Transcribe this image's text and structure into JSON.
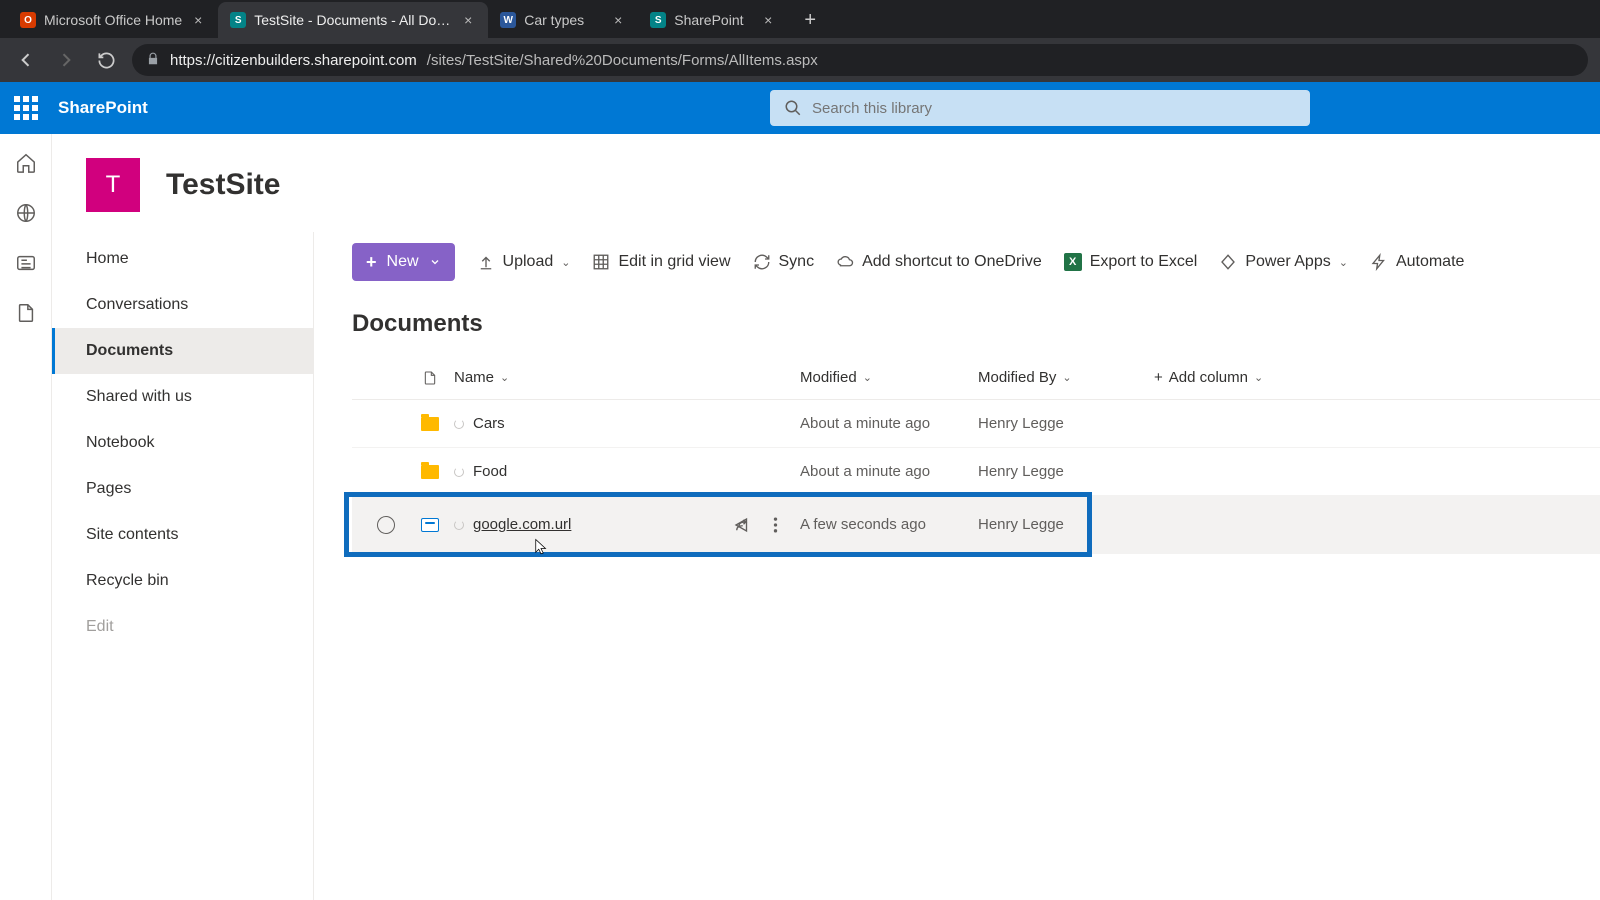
{
  "browser": {
    "tabs": [
      {
        "title": "Microsoft Office Home",
        "favicon": "office"
      },
      {
        "title": "TestSite - Documents - All Docum",
        "favicon": "sp",
        "active": true
      },
      {
        "title": "Car types",
        "favicon": "word"
      },
      {
        "title": "SharePoint",
        "favicon": "sp"
      }
    ],
    "url_host": "https://citizenbuilders.sharepoint.com",
    "url_path": "/sites/TestSite/Shared%20Documents/Forms/AllItems.aspx"
  },
  "suite": {
    "product": "SharePoint",
    "search_placeholder": "Search this library"
  },
  "site": {
    "logo_letter": "T",
    "title": "TestSite"
  },
  "leftnav": {
    "items": [
      "Home",
      "Conversations",
      "Documents",
      "Shared with us",
      "Notebook",
      "Pages",
      "Site contents",
      "Recycle bin"
    ],
    "edit": "Edit",
    "selected_index": 2
  },
  "commands": {
    "new": "New",
    "upload": "Upload",
    "edit_grid": "Edit in grid view",
    "sync": "Sync",
    "add_shortcut": "Add shortcut to OneDrive",
    "export_excel": "Export to Excel",
    "power_apps": "Power Apps",
    "automate": "Automate"
  },
  "library": {
    "title": "Documents",
    "columns": {
      "name": "Name",
      "modified": "Modified",
      "modified_by": "Modified By",
      "add_column": "Add column"
    },
    "rows": [
      {
        "type": "folder",
        "name": "Cars",
        "modified": "About a minute ago",
        "modified_by": "Henry Legge"
      },
      {
        "type": "folder",
        "name": "Food",
        "modified": "About a minute ago",
        "modified_by": "Henry Legge"
      },
      {
        "type": "link",
        "name": "google.com.url",
        "modified": "A few seconds ago",
        "modified_by": "Henry Legge",
        "hovered": true,
        "highlighted": true
      }
    ]
  }
}
